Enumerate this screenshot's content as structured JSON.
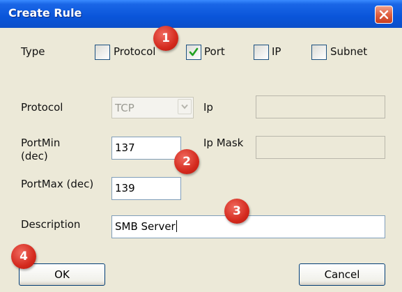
{
  "dialog": {
    "title": "Create Rule"
  },
  "type_row": {
    "label": "Type",
    "options": [
      {
        "label": "Protocol",
        "checked": false
      },
      {
        "label": "Port",
        "checked": true
      },
      {
        "label": "IP",
        "checked": false
      },
      {
        "label": "Subnet",
        "checked": false
      }
    ]
  },
  "protocol": {
    "label": "Protocol",
    "value": "TCP",
    "enabled": false
  },
  "ip": {
    "label": "Ip",
    "value": ""
  },
  "ip_mask": {
    "label": "Ip Mask",
    "value": ""
  },
  "port_min": {
    "label_line1": "PortMin",
    "label_line2": "(dec)",
    "value": "137"
  },
  "port_max": {
    "label": "PortMax (dec)",
    "value": "139"
  },
  "description": {
    "label": "Description",
    "value": "SMB Server"
  },
  "buttons": {
    "ok": "OK",
    "cancel": "Cancel"
  },
  "annotations": [
    "1",
    "2",
    "3",
    "4"
  ],
  "colors": {
    "title_bar": "#0a55da",
    "dialog_bg": "#ece9d8",
    "badge": "#d42a1e",
    "check": "#21a121"
  }
}
